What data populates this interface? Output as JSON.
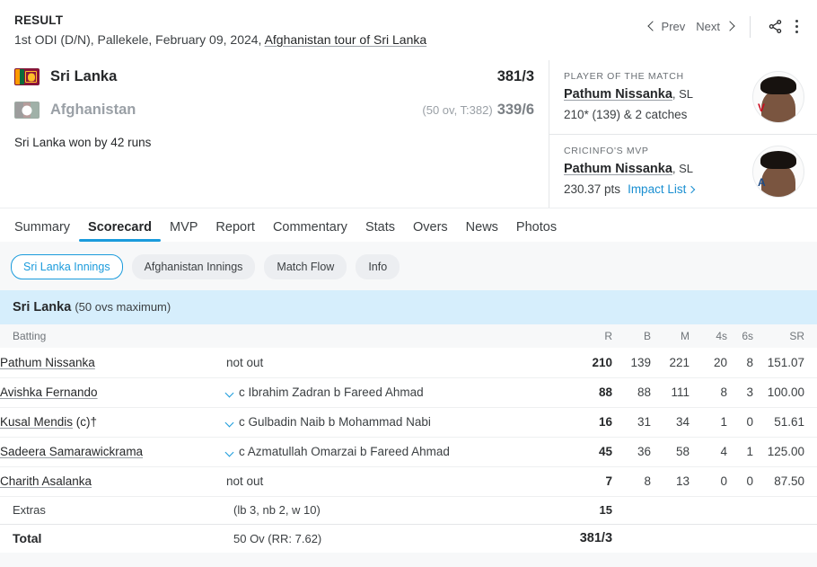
{
  "header": {
    "result_label": "RESULT",
    "match_description_prefix": "1st ODI (D/N), Pallekele, February 09, 2024, ",
    "series_link": "Afghanistan tour of Sri Lanka",
    "prev_label": "Prev",
    "next_label": "Next"
  },
  "teams": [
    {
      "name": "Sri Lanka",
      "score": "381/3",
      "overs": "",
      "flag": "sri-lanka-flag",
      "dim": false
    },
    {
      "name": "Afghanistan",
      "score": "339/6",
      "overs": "(50 ov, T:382)",
      "flag": "afghanistan-flag",
      "dim": true
    }
  ],
  "result_note": "Sri Lanka won by 42 runs",
  "info_cards": [
    {
      "kicker": "PLAYER OF THE MATCH",
      "player": "Pathum Nissanka",
      "team": ", SL",
      "stat": "210* (139) & 2 catches",
      "link": "",
      "badge": "V"
    },
    {
      "kicker": "CRICINFO'S MVP",
      "player": "Pathum Nissanka",
      "team": ", SL",
      "stat": "230.37 pts",
      "link": "Impact List",
      "badge": "A"
    }
  ],
  "tabs": [
    {
      "label": "Summary",
      "active": false
    },
    {
      "label": "Scorecard",
      "active": true
    },
    {
      "label": "MVP",
      "active": false
    },
    {
      "label": "Report",
      "active": false
    },
    {
      "label": "Commentary",
      "active": false
    },
    {
      "label": "Stats",
      "active": false
    },
    {
      "label": "Overs",
      "active": false
    },
    {
      "label": "News",
      "active": false
    },
    {
      "label": "Photos",
      "active": false
    }
  ],
  "chips": [
    {
      "label": "Sri Lanka Innings",
      "active": true
    },
    {
      "label": "Afghanistan Innings",
      "active": false
    },
    {
      "label": "Match Flow",
      "active": false
    },
    {
      "label": "Info",
      "active": false
    }
  ],
  "innings": {
    "team": "Sri Lanka",
    "overs_note": "(50 ovs maximum)",
    "columns": [
      "Batting",
      "R",
      "B",
      "M",
      "4s",
      "6s",
      "SR"
    ],
    "batsmen": [
      {
        "name": "Pathum Nissanka",
        "role": "",
        "dismissal": "not out",
        "has_chevron": false,
        "r": "210",
        "b": "139",
        "m": "221",
        "fours": "20",
        "sixes": "8",
        "sr": "151.07"
      },
      {
        "name": "Avishka Fernando",
        "role": "",
        "dismissal": "c Ibrahim Zadran b Fareed Ahmad",
        "has_chevron": true,
        "r": "88",
        "b": "88",
        "m": "111",
        "fours": "8",
        "sixes": "3",
        "sr": "100.00"
      },
      {
        "name": "Kusal Mendis",
        "role": " (c)†",
        "dismissal": "c Gulbadin Naib b Mohammad Nabi",
        "has_chevron": true,
        "r": "16",
        "b": "31",
        "m": "34",
        "fours": "1",
        "sixes": "0",
        "sr": "51.61"
      },
      {
        "name": "Sadeera Samarawickrama",
        "role": "",
        "dismissal": "c Azmatullah Omarzai b Fareed Ahmad",
        "has_chevron": true,
        "r": "45",
        "b": "36",
        "m": "58",
        "fours": "4",
        "sixes": "1",
        "sr": "125.00"
      },
      {
        "name": "Charith Asalanka",
        "role": "",
        "dismissal": "not out",
        "has_chevron": false,
        "r": "7",
        "b": "8",
        "m": "13",
        "fours": "0",
        "sixes": "0",
        "sr": "87.50"
      }
    ],
    "extras": {
      "label": "Extras",
      "detail": "(lb 3, nb 2, w 10)",
      "value": "15"
    },
    "total": {
      "label": "Total",
      "detail": "50 Ov (RR: 7.62)",
      "value": "381/3"
    }
  },
  "colors": {
    "accent": "#1a9bdc",
    "innings_banner": "#d6eefc",
    "page_bg": "#f7f8f9"
  }
}
